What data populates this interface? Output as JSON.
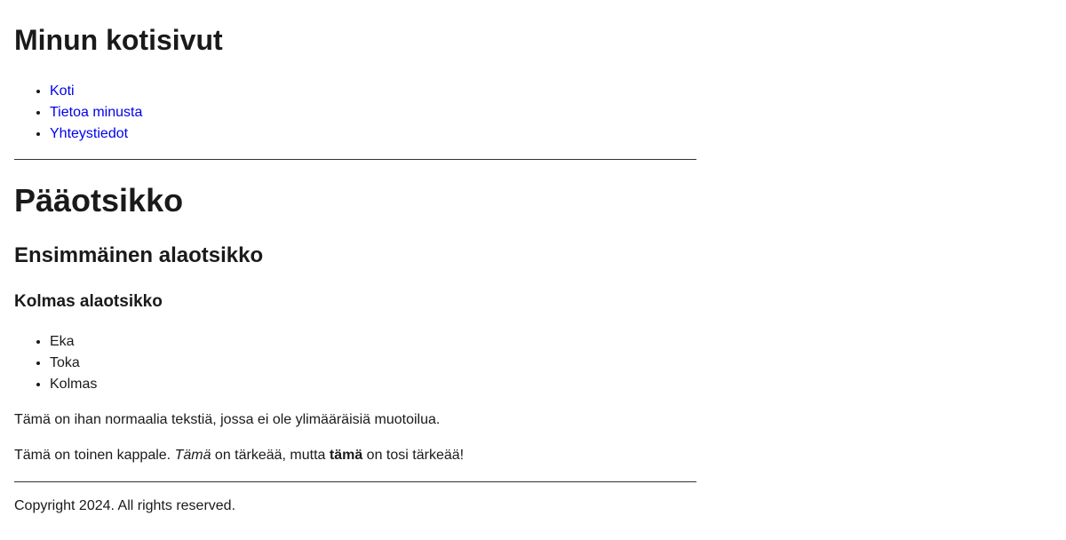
{
  "header": {
    "title": "Minun kotisivut",
    "nav": [
      {
        "label": "Koti"
      },
      {
        "label": "Tietoa minusta"
      },
      {
        "label": "Yhteystiedot"
      }
    ]
  },
  "main": {
    "heading": "Pääotsikko",
    "subheading": "Ensimmäinen alaotsikko",
    "third_heading": "Kolmas alaotsikko",
    "list": [
      "Eka",
      "Toka",
      "Kolmas"
    ],
    "paragraph1": "Tämä on ihan normaalia tekstiä, jossa ei ole ylimääräisiä muotoilua.",
    "paragraph2": {
      "start": "Tämä on toinen kappale. ",
      "em": "Tämä",
      "middle": " on tärkeää, mutta ",
      "strong": "tämä",
      "end": " on tosi tärkeää!"
    }
  },
  "footer": {
    "text": "Copyright 2024. All rights reserved."
  },
  "colors": {
    "link": "#0000ee",
    "text": "#1a1a1a",
    "rule": "#333333",
    "background": "#ffffff"
  }
}
